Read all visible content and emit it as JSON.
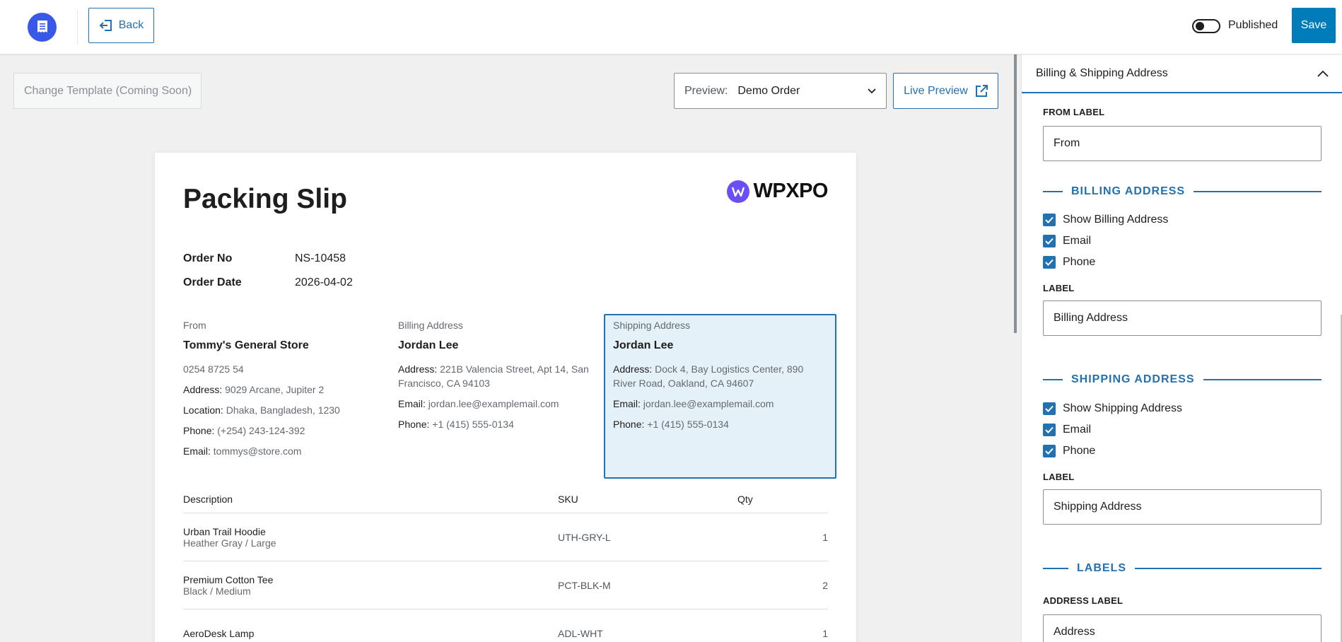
{
  "topbar": {
    "back_label": "Back",
    "published_label": "Published",
    "published_on": false,
    "save_label": "Save"
  },
  "toolbar": {
    "change_template_label": "Change Template (Coming Soon)",
    "preview_label": "Preview:",
    "preview_value": "Demo Order",
    "live_preview_label": "Live Preview"
  },
  "document": {
    "title": "Packing Slip",
    "brand": "WPXPO",
    "order_no_label": "Order No",
    "order_no": "NS-10458",
    "order_date_label": "Order Date",
    "order_date": "2026-04-02",
    "from": {
      "heading": "From",
      "name": "Tommy's General Store",
      "phone_plain": "0254 8725 54",
      "address_label": "Address:",
      "address": "9029 Arcane, Jupiter 2",
      "location_label": "Location:",
      "location": "Dhaka, Bangladesh, 1230",
      "phone_label": "Phone:",
      "phone": "(+254) 243-124-392",
      "email_label": "Email:",
      "email": "tommys@store.com"
    },
    "billing": {
      "heading": "Billing Address",
      "name": "Jordan Lee",
      "address_label": "Address:",
      "address": "221B Valencia Street, Apt 14, San Francisco, CA 94103",
      "email_label": "Email:",
      "email": "jordan.lee@examplemail.com",
      "phone_label": "Phone:",
      "phone": "+1 (415) 555-0134"
    },
    "shipping": {
      "heading": "Shipping Address",
      "name": "Jordan Lee",
      "address_label": "Address:",
      "address": "Dock 4, Bay Logistics Center, 890 River Road, Oakland, CA 94607",
      "email_label": "Email:",
      "email": "jordan.lee@examplemail.com",
      "phone_label": "Phone:",
      "phone": "+1 (415) 555-0134"
    },
    "table": {
      "headers": [
        "Description",
        "SKU",
        "Qty"
      ],
      "rows": [
        {
          "name": "Urban Trail Hoodie",
          "variant": "Heather Gray / Large",
          "sku": "UTH-GRY-L",
          "qty": "1"
        },
        {
          "name": "Premium Cotton Tee",
          "variant": "Black / Medium",
          "sku": "PCT-BLK-M",
          "qty": "2"
        },
        {
          "name": "AeroDesk Lamp",
          "variant": "",
          "sku": "ADL-WHT",
          "qty": "1"
        }
      ]
    }
  },
  "panel": {
    "section_title": "Billing & Shipping Address",
    "from_label_title": "FROM LABEL",
    "from_label_value": "From",
    "billing_heading": "BILLING ADDRESS",
    "billing_checks": [
      "Show Billing Address",
      "Email",
      "Phone"
    ],
    "billing_label_title": "LABEL",
    "billing_label_value": "Billing Address",
    "shipping_heading": "SHIPPING ADDRESS",
    "shipping_checks": [
      "Show Shipping Address",
      "Email",
      "Phone"
    ],
    "shipping_label_title": "LABEL",
    "shipping_label_value": "Shipping Address",
    "labels_heading": "LABELS",
    "address_label_title": "ADDRESS LABEL",
    "address_label_value": "Address"
  },
  "colors": {
    "accent": "#2271b1",
    "logo": "#3858e9",
    "brand_mark": "#6b4ef6",
    "shipping_highlight": "#e5f1f8"
  }
}
